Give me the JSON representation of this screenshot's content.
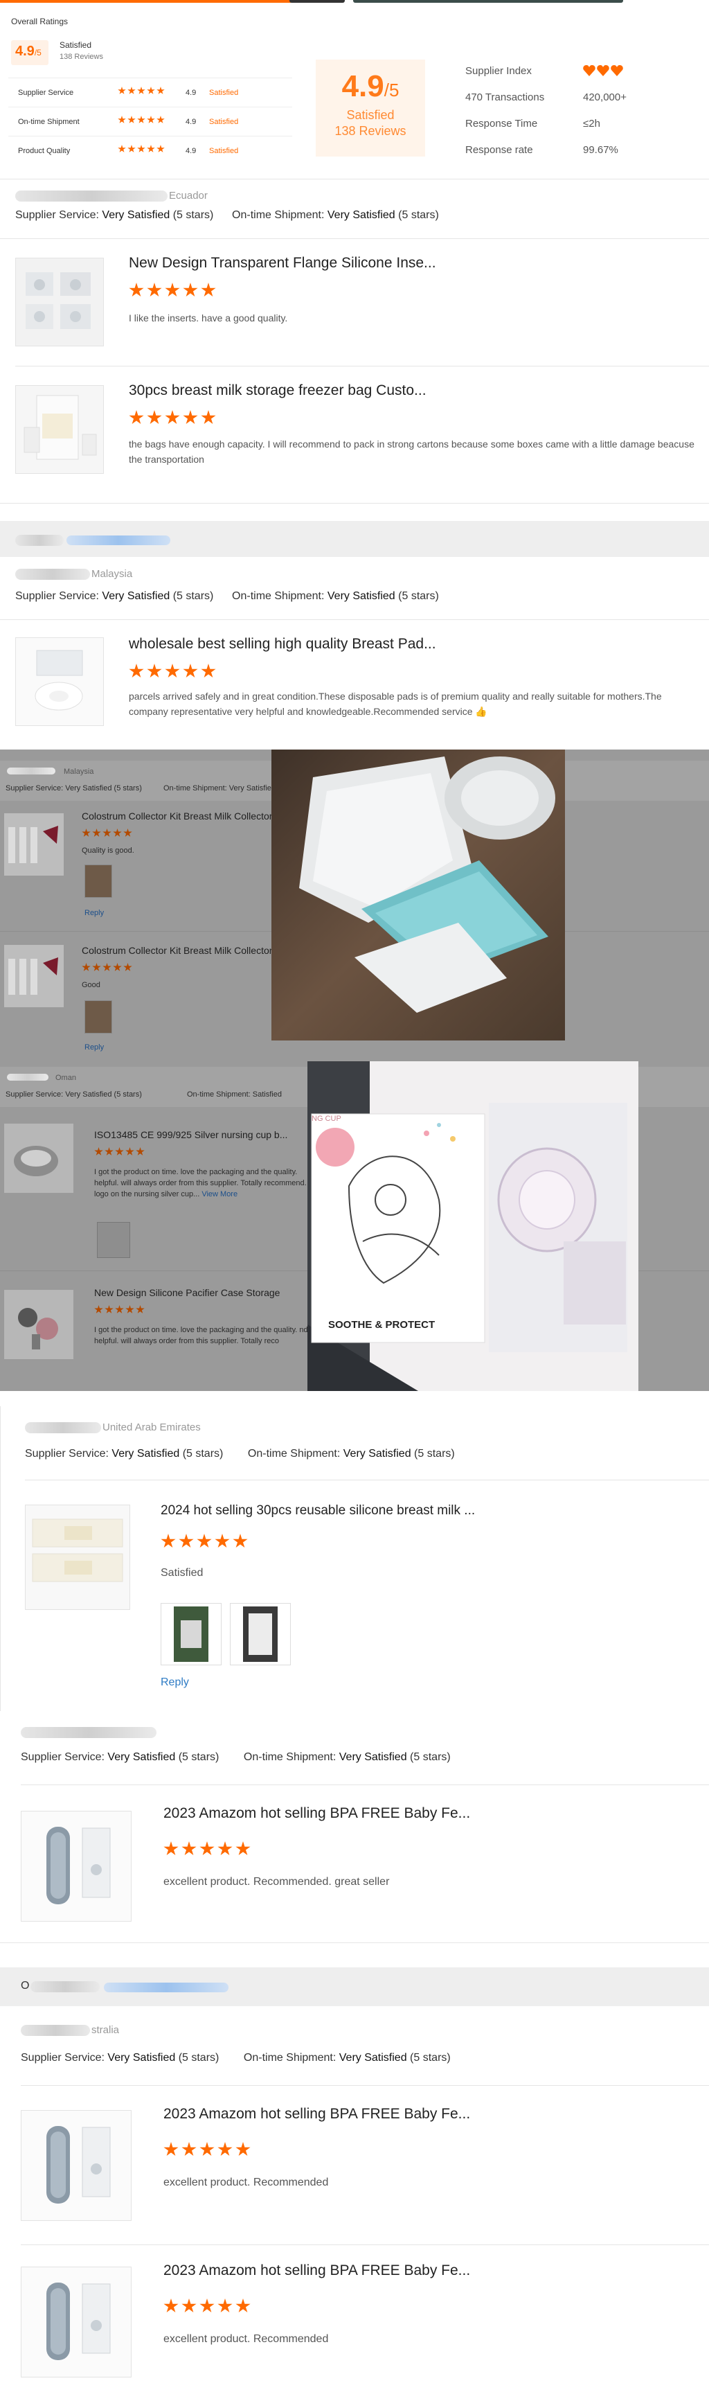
{
  "overall": {
    "title": "Overall Ratings",
    "score": "4.9",
    "score_out_of": "/5",
    "satisfied": "Satisfied",
    "reviews": "138 Reviews",
    "rows": [
      {
        "label": "Supplier Service",
        "value": "4.9",
        "text": "Satisfied"
      },
      {
        "label": "On-time Shipment",
        "value": "4.9",
        "text": "Satisfied"
      },
      {
        "label": "Product Quality",
        "value": "4.9",
        "text": "Satisfied"
      }
    ],
    "big_score": "4.9",
    "big_out_of": "/5",
    "big_satisfied": "Satisfied",
    "big_reviews": "138 Reviews",
    "supplier_index_label": "Supplier Index",
    "transactions_label": "470 Transactions",
    "transactions_value": "420,000+",
    "response_time_label": "Response Time",
    "response_time_value": "≤2h",
    "response_rate_label": "Response rate",
    "response_rate_value": "99.67%"
  },
  "reviews": [
    {
      "country": "Ecuador",
      "service": "Supplier Service:",
      "service_val": "Very Satisfied",
      "service_stars": "(5 stars)",
      "ship": "On-time Shipment:",
      "ship_val": "Very Satisfied",
      "ship_stars": "(5 stars)",
      "items": [
        {
          "title": "New Design Transparent Flange Silicone Inse...",
          "comment": "I like the inserts. have a good quality."
        },
        {
          "title": "30pcs breast milk storage freezer bag Custo...",
          "comment": "the bags have enough capacity. I will recommend to pack in strong cartons because some boxes came with a little damage beacuse the transportation"
        }
      ]
    },
    {
      "country": "Malaysia",
      "service": "Supplier Service:",
      "service_val": "Very Satisfied",
      "service_stars": "(5 stars)",
      "ship": "On-time Shipment:",
      "ship_val": "Very Satisfied",
      "ship_stars": "(5 stars)",
      "items": [
        {
          "title": "wholesale best selling high quality Breast Pad...",
          "comment": "parcels arrived safely and in great condition.These disposable pads is of premium quality and really suitable for mothers.The company representative very helpful and knowledgeable.Recommended service 👍"
        }
      ]
    },
    {
      "country": "Malaysia",
      "service": "Supplier Service:",
      "service_val": "Very Satisfied",
      "service_stars": "(5 stars)",
      "ship": "On-time Shipment:",
      "ship_val": "Very Satisfied",
      "items": [
        {
          "title": "Colostrum Collector Kit Breast Milk Collector",
          "comment": "Quality is good.",
          "reply": "Reply"
        },
        {
          "title": "Colostrum Collector Kit Breast Milk Collector",
          "comment": "Good",
          "reply": "Reply"
        }
      ]
    },
    {
      "country": "Oman",
      "service": "Supplier Service:",
      "service_val": "Very Satisfied",
      "service_stars": "(5 stars)",
      "ship": "On-time Shipment:",
      "ship_val": "Satisfied",
      "items": [
        {
          "title": "ISO13485 CE 999/925 Silver nursing cup b...",
          "comment": "I got the product on time. love the packaging and the quality. helpful. will always order from this supplier. Totally recommend. logo on the nursing silver cup...",
          "more": "View More"
        },
        {
          "title": "New Design Silicone Pacifier Case Storage",
          "comment": "I got the product on time. love the packaging and the quality. nd helpful. will always order from this supplier. Totally reco"
        }
      ]
    },
    {
      "country": "United Arab Emirates",
      "service": "Supplier Service:",
      "service_val": "Very Satisfied",
      "service_stars": "(5 stars)",
      "ship": "On-time Shipment:",
      "ship_val": "Very Satisfied",
      "ship_stars": "(5 stars)",
      "items": [
        {
          "title": "2024 hot selling 30pcs reusable silicone breast milk ...",
          "comment": "Satisfied",
          "reply": "Reply"
        }
      ]
    },
    {
      "country": "",
      "service": "Supplier Service:",
      "service_val": "Very Satisfied",
      "service_stars": "(5 stars)",
      "ship": "On-time Shipment:",
      "ship_val": "Very Satisfied",
      "ship_stars": "(5 stars)",
      "items": [
        {
          "title": "2023 Amazom hot selling BPA FREE Baby Fe...",
          "comment": "excellent product. Recommended. great seller"
        }
      ]
    },
    {
      "country": "stralia",
      "service": "Supplier Service:",
      "service_val": "Very Satisfied",
      "service_stars": "(5 stars)",
      "ship": "On-time Shipment:",
      "ship_val": "Very Satisfied",
      "ship_stars": "(5 stars)",
      "items": [
        {
          "title": "2023 Amazom hot selling BPA FREE Baby Fe...",
          "comment": "excellent product. Recommended"
        },
        {
          "title": "2023 Amazom hot selling BPA FREE Baby Fe...",
          "comment": "excellent product. Recommended"
        }
      ]
    }
  ],
  "photo_text": {
    "soothe": "SOOTHE & PROTECT",
    "cup": "NG CUP"
  },
  "order_initial": "O",
  "colors": {
    "accent": "#ff6a00",
    "link": "#2d7bc4"
  }
}
